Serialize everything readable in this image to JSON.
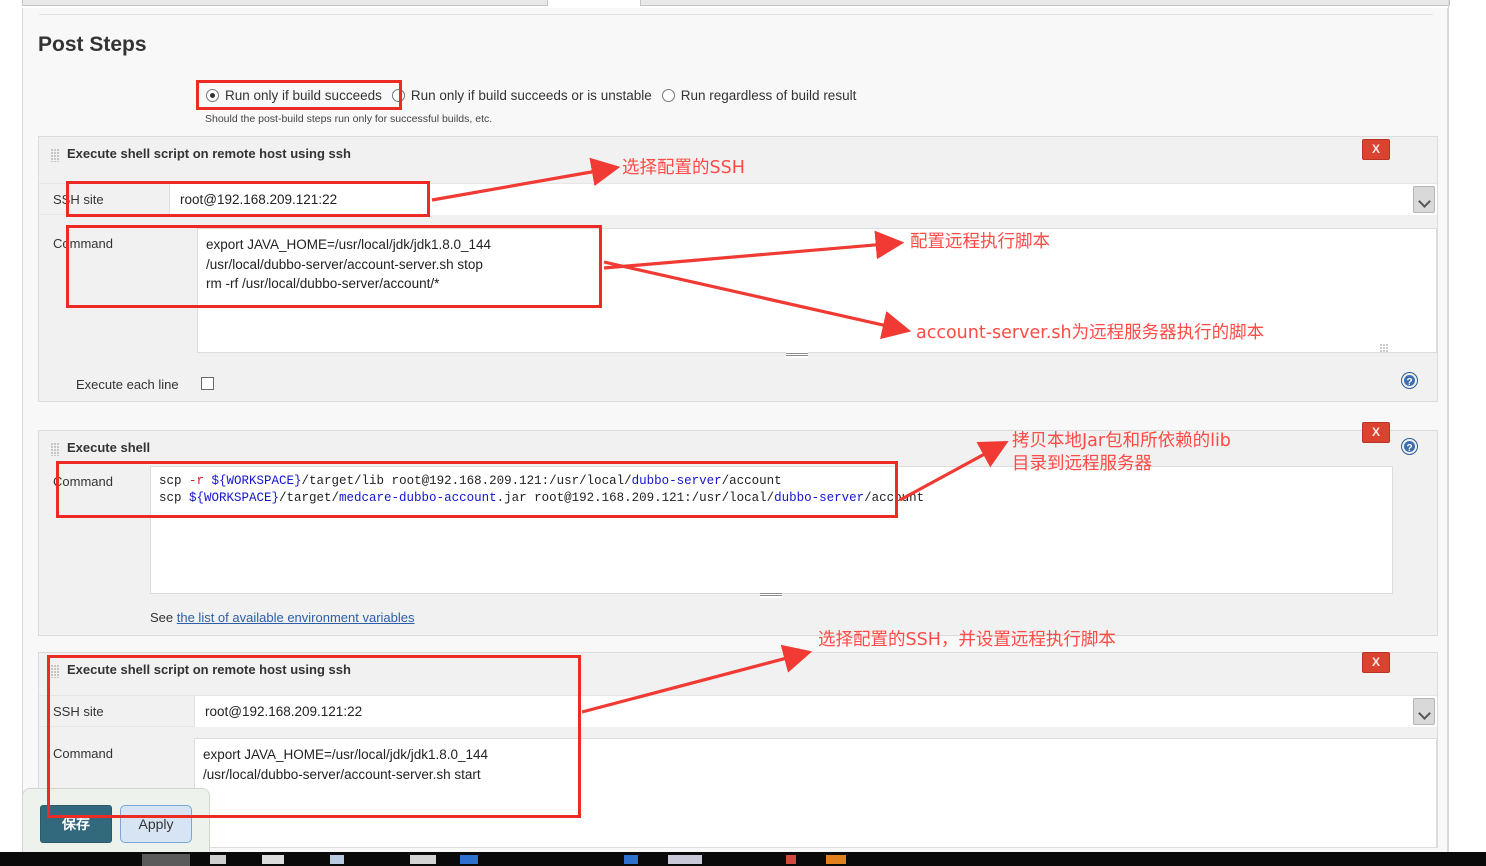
{
  "page": {
    "title": "Post Steps",
    "radio": {
      "options": [
        {
          "label": "Run only if build succeeds",
          "selected": true
        },
        {
          "label": "Run only if build succeeds or is unstable",
          "selected": false
        },
        {
          "label": "Run regardless of build result",
          "selected": false
        }
      ],
      "hint": "Should the post-build steps run only for successful builds, etc."
    }
  },
  "blocks": [
    {
      "title": "Execute shell script on remote host using ssh",
      "close_label": "X",
      "ssh_label": "SSH site",
      "ssh_value": "root@192.168.209.121:22",
      "command_label": "Command",
      "command_value": "export JAVA_HOME=/usr/local/jdk/jdk1.8.0_144\n/usr/local/dubbo-server/account-server.sh stop\nrm -rf /usr/local/dubbo-server/account/*",
      "execute_each_line_label": "Execute each line",
      "help_label": "?"
    },
    {
      "title": "Execute shell",
      "close_label": "X",
      "command_label": "Command",
      "command_line1": "scp -r ${WORKSPACE}/target/lib root@192.168.209.121:/usr/local/dubbo-server/account",
      "command_line2": "scp ${WORKSPACE}/target/medcare-dubbo-account.jar root@192.168.209.121:/usr/local/dubbo-server/account",
      "see_prefix": "See ",
      "see_link": "the list of available environment variables",
      "help_label": "?"
    },
    {
      "title": "Execute shell script on remote host using ssh",
      "close_label": "X",
      "ssh_label": "SSH site",
      "ssh_value": "root@192.168.209.121:22",
      "command_label": "Command",
      "command_value": "export JAVA_HOME=/usr/local/jdk/jdk1.8.0_144\n/usr/local/dubbo-server/account-server.sh start"
    }
  ],
  "annotations": [
    {
      "id": "a1",
      "text": "选择配置的SSH"
    },
    {
      "id": "a2",
      "text": "配置远程执行脚本"
    },
    {
      "id": "a3",
      "text": "account-server.sh为远程服务器执行的脚本"
    },
    {
      "id": "a4",
      "text": "拷贝本地Jar包和所依赖的lib\n目录到远程服务器"
    },
    {
      "id": "a5",
      "text": "选择配置的SSH，并设置远程执行脚本"
    }
  ],
  "footer": {
    "save_label": "保存",
    "apply_label": "Apply"
  },
  "colors": {
    "annotation": "#ff4a45",
    "highlight": "#ec2b24",
    "close_button": "#d9432f",
    "save_button": "#33697d",
    "apply_button": "#d6e4f4",
    "link": "#2b5fa8"
  }
}
